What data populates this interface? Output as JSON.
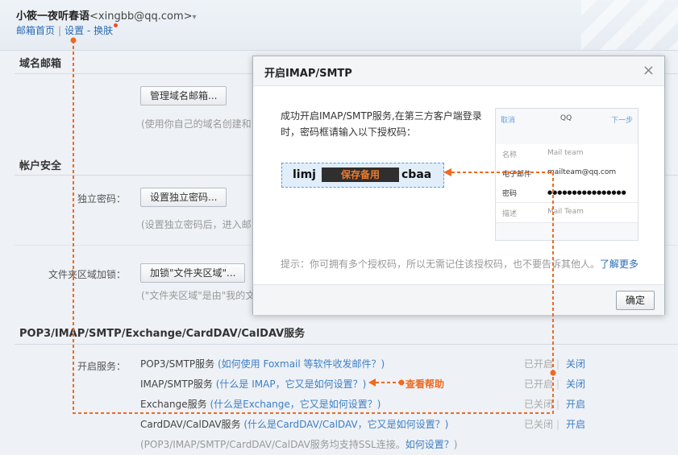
{
  "header": {
    "user_name": "小筱一夜听春语",
    "user_email": "<xingbb@qq.com>",
    "caret": "▾",
    "link_home": "邮箱首页",
    "link_settings": "设置",
    "link_dash": "-",
    "link_skin": "换肤"
  },
  "sections": {
    "domain": {
      "title": "域名邮箱",
      "button": "管理域名邮箱...",
      "hint": "(使用你自己的域名创建和"
    },
    "security": {
      "title": "帐户安全",
      "pwd_label": "独立密码：",
      "pwd_button": "设置独立密码...",
      "pwd_hint": "(设置独立密码后，进入邮",
      "lock_label": "文件夹区域加锁：",
      "lock_button": "加锁\"文件夹区域\"...",
      "lock_hint": "(\"文件夹区域\"是由\"我的文"
    },
    "services": {
      "title": "POP3/IMAP/SMTP/Exchange/CardDAV/CalDAV服务",
      "open_label": "开启服务：",
      "rows": [
        {
          "name": "POP3/SMTP服务",
          "link": "(如何使用 Foxmail 等软件收发邮件？)",
          "status": "已开启",
          "action": "关闭"
        },
        {
          "name": "IMAP/SMTP服务",
          "link": "(什么是 IMAP，它又是如何设置？)",
          "status": "已开启",
          "action": "关闭"
        },
        {
          "name": "Exchange服务",
          "link": "(什么是Exchange，它又是如何设置？)",
          "status": "已关闭",
          "action": "开启"
        },
        {
          "name": "CardDAV/CalDAV服务",
          "link": "(什么是CardDAV/CalDAV，它又是如何设置？)",
          "status": "已关闭",
          "action": "开启"
        }
      ],
      "footnote_text": "(POP3/IMAP/SMTP/CardDAV/CalDAV服务均支持SSL连接。",
      "footnote_link": "如何设置？",
      "footnote_end": ")",
      "annotation": "查看帮助"
    }
  },
  "modal": {
    "title": "开启IMAP/SMTP",
    "close": "×",
    "text": "成功开启IMAP/SMTP服务,在第三方客户端登录时，密码框请输入以下授权码：",
    "code_start": "limj",
    "code_hidden": "保存备用",
    "code_end": "cbaa",
    "phone": {
      "cancel": "取消",
      "brand": "QQ",
      "next": "下一步",
      "rows": [
        {
          "label": "名称",
          "value": "Mail team"
        },
        {
          "label": "电子邮件",
          "value": "mailteam@qq.com"
        },
        {
          "label": "密码",
          "value": "●●●●●●●●●●●●●●●●"
        },
        {
          "label": "描述",
          "value": "Mail Team"
        }
      ]
    },
    "tip": "提示：你可拥有多个授权码，所以无需记住该授权码，也不要告诉其他人。",
    "tip_link": "了解更多",
    "ok": "确定"
  },
  "colors": {
    "link": "#2a6ab5",
    "annotation": "#ef6a1f",
    "code_border": "#4aa3e0"
  }
}
